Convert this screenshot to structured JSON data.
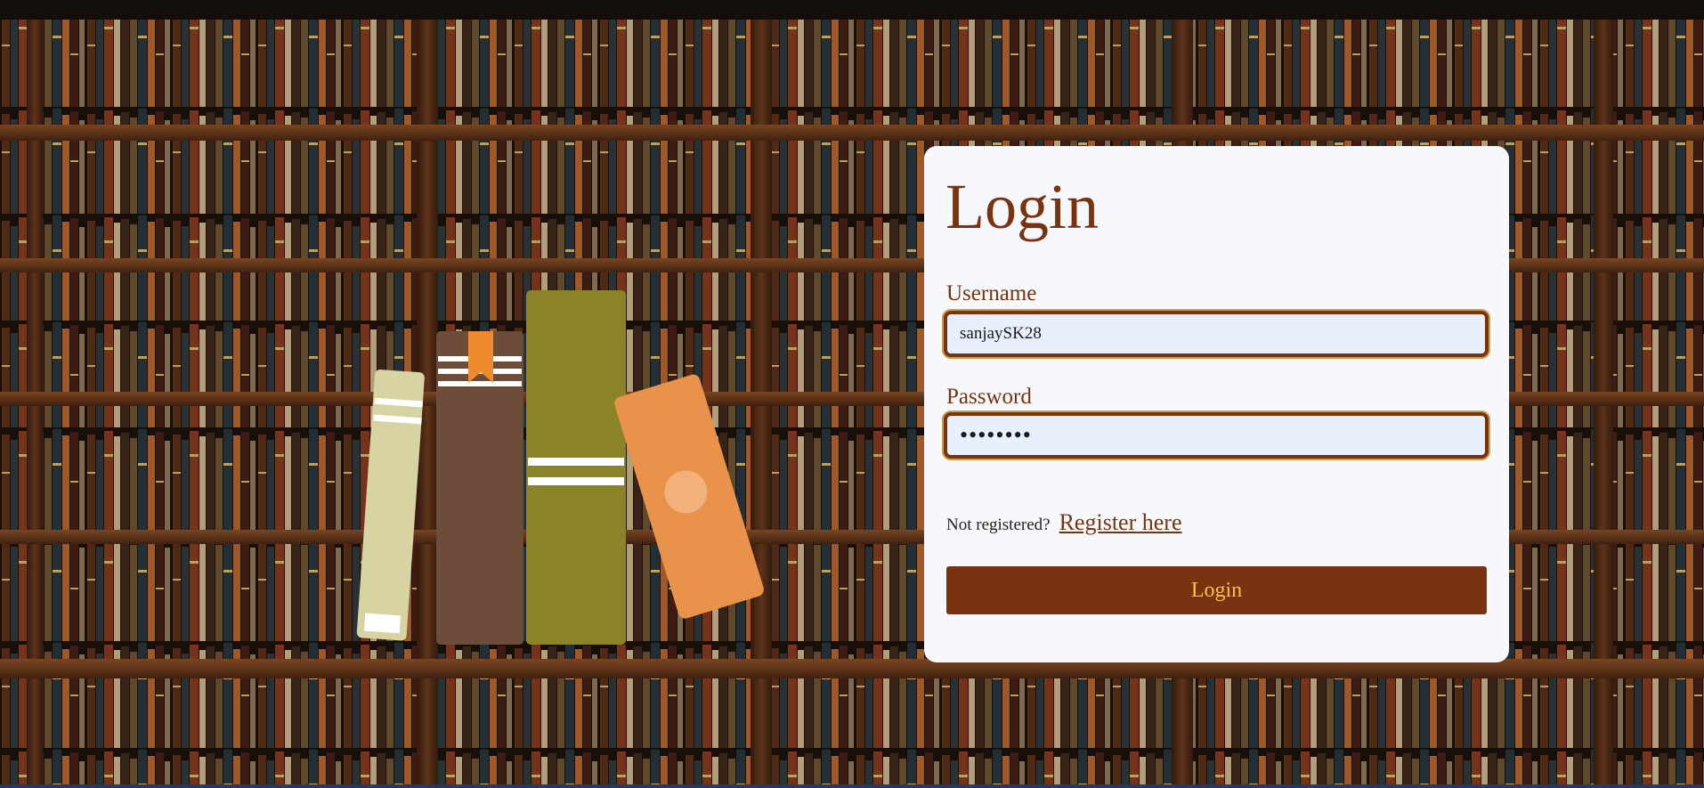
{
  "form": {
    "title": "Login",
    "username_label": "Username",
    "username_value": "sanjaySK28",
    "password_label": "Password",
    "password_value": "••••••••",
    "register_prompt": "Not registered?",
    "register_link": "Register here",
    "submit_label": "Login"
  },
  "colors": {
    "accent": "#7a3310",
    "button_text": "#f5c542",
    "card_background": "#f7f8fb",
    "input_background": "#e8f0fe"
  }
}
